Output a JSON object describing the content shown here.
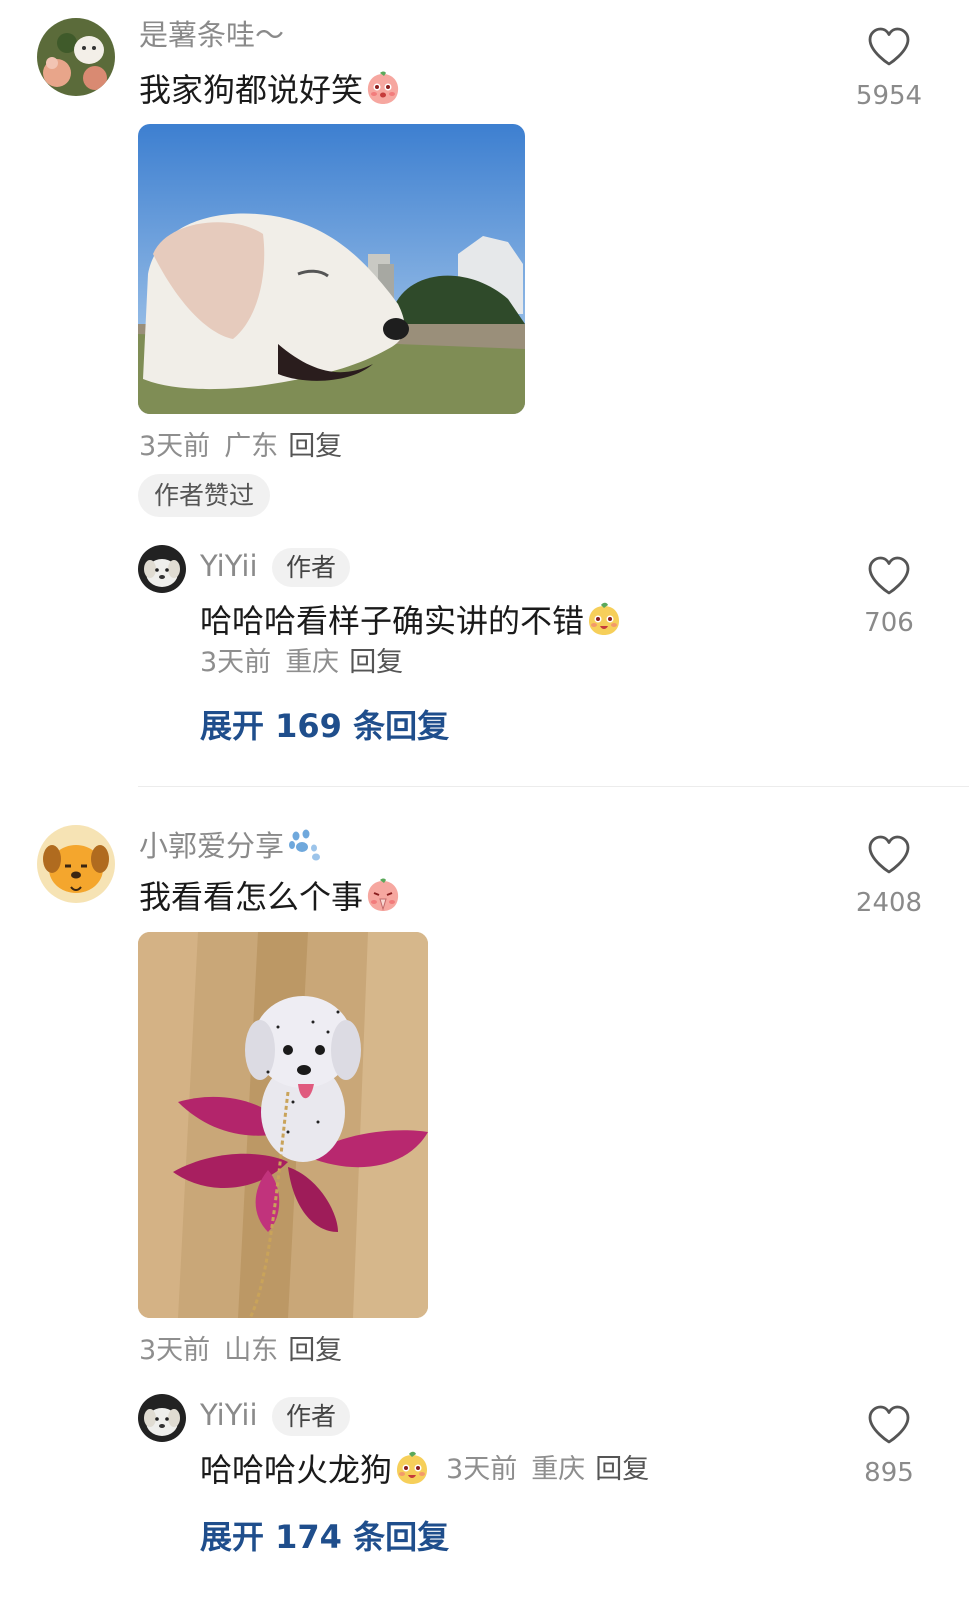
{
  "comments": [
    {
      "username": "是薯条哇～",
      "text": "我家狗都说好笑",
      "emoji": "blush-peach-emoji",
      "image": "dog-photo",
      "time": "3天前",
      "location": "广东",
      "reply_label": "回复",
      "liked_by_author": "作者赞过",
      "likes": "5954",
      "reply": {
        "username": "YiYii",
        "badge": "作者",
        "text": "哈哈哈看样子确实讲的不错",
        "emoji": "yellow-face-emoji",
        "time": "3天前",
        "location": "重庆",
        "reply_label": "回复",
        "likes": "706"
      },
      "expand_label": "展开 169 条回复"
    },
    {
      "username": "小郭爱分享",
      "username_emoji": "paw-emoji",
      "text": "我看看怎么个事",
      "emoji": "praying-peach-emoji",
      "image": "dragonfruit-dog-photo",
      "time": "3天前",
      "location": "山东",
      "reply_label": "回复",
      "likes": "2408",
      "reply": {
        "username": "YiYii",
        "badge": "作者",
        "text": "哈哈哈火龙狗",
        "emoji": "yellow-face-emoji",
        "time": "3天前",
        "location": "重庆",
        "reply_label": "回复",
        "likes": "895"
      },
      "expand_label": "展开 174 条回复"
    }
  ],
  "colors": {
    "link": "#1f4e8c",
    "meta": "#8e8e8e",
    "chip_bg": "#f1f1f1"
  }
}
